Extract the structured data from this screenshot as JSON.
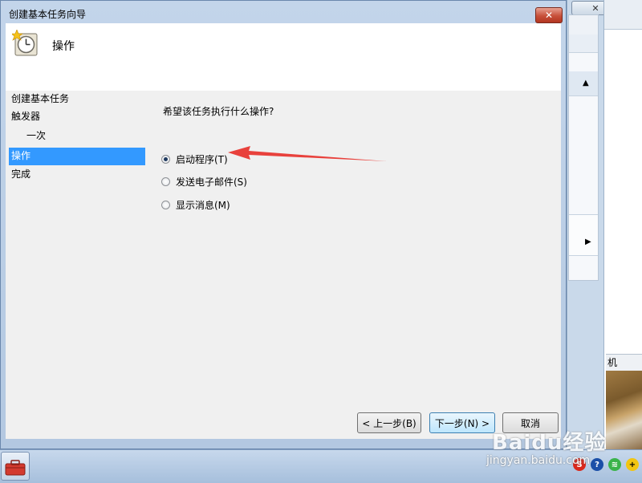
{
  "dialog": {
    "title": "创建基本任务向导",
    "close_glyph": "✕",
    "header_title": "操作",
    "question": "希望该任务执行什么操作?"
  },
  "nav": {
    "items": [
      {
        "label": "创建基本任务"
      },
      {
        "label": "触发器"
      },
      {
        "label": "一次"
      },
      {
        "label": "操作",
        "selected": true
      },
      {
        "label": "完成"
      }
    ]
  },
  "options": [
    {
      "label": "启动程序(T)",
      "checked": true
    },
    {
      "label": "发送电子邮件(S)",
      "checked": false
    },
    {
      "label": "显示消息(M)",
      "checked": false
    }
  ],
  "buttons": {
    "back": "< 上一步(B)",
    "next": "下一步(N) >",
    "cancel": "取消"
  },
  "background_window": {
    "close_glyph": "✕",
    "label_fragment": "机",
    "scroll_up_glyph": "▲",
    "expand_glyph": "▶"
  },
  "watermark": {
    "brand": "Baidu经验",
    "url": "jingyan.baidu.com"
  },
  "colors": {
    "selection": "#3399ff",
    "annotation_arrow": "#e8413c",
    "close_button": "#c7503a"
  }
}
